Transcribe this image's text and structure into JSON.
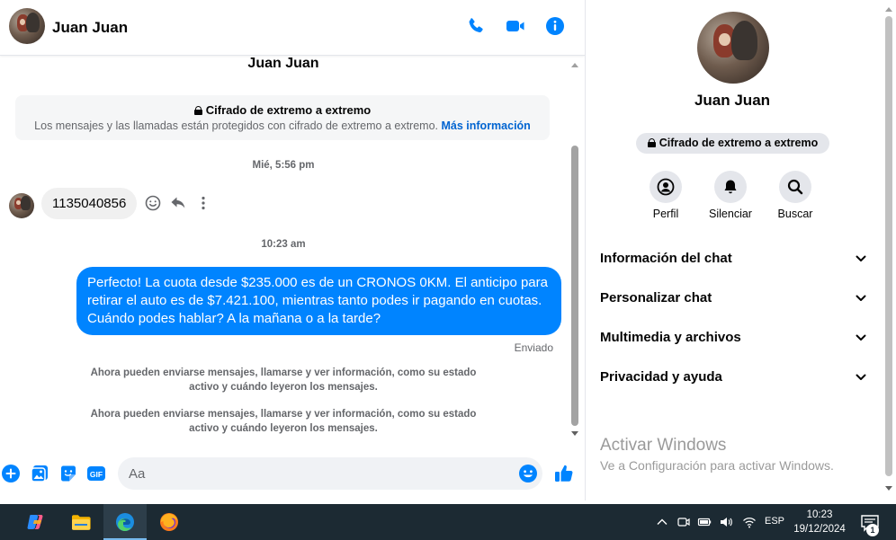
{
  "header": {
    "name": "Juan Juan"
  },
  "thread": {
    "title": "Juan Juan",
    "e2e_title": "Cifrado de extremo a extremo",
    "e2e_text": "Los mensajes y las llamadas están protegidos con cifrado de extremo a extremo.",
    "e2e_link": "Más información",
    "timestamp_1": "Mié, 5:56 pm",
    "incoming_message": "1135040856",
    "timestamp_2": "10:23 am",
    "outgoing_message": "Perfecto! La cuota desde $235.000 es de un CRONOS 0KM. El anticipo para retirar el auto es de $7.421.100, mientras tanto podes ir pagando en cuotas. Cuándo podes hablar? A la mañana o a la tarde?",
    "sent_status": "Enviado",
    "system_message_1": "Ahora pueden enviarse mensajes, llamarse y ver información, como su estado activo y cuándo leyeron los mensajes.",
    "system_message_2": "Ahora pueden enviarse mensajes, llamarse y ver información, como su estado activo y cuándo leyeron los mensajes."
  },
  "composer": {
    "placeholder": "Aa",
    "gif_label": "GIF"
  },
  "info": {
    "name": "Juan Juan",
    "e2e_badge": "Cifrado de extremo a extremo",
    "actions": {
      "profile": "Perfil",
      "mute": "Silenciar",
      "search": "Buscar"
    },
    "sections": [
      "Información del chat",
      "Personalizar chat",
      "Multimedia y archivos",
      "Privacidad y ayuda"
    ]
  },
  "watermark": {
    "title": "Activar Windows",
    "subtitle": "Ve a Configuración para activar Windows."
  },
  "taskbar": {
    "language": "ESP",
    "time": "10:23",
    "date": "19/12/2024",
    "notification_count": "1"
  },
  "colors": {
    "accent": "#0084ff",
    "link": "#0064d1",
    "taskbar": "#1c2a33"
  }
}
